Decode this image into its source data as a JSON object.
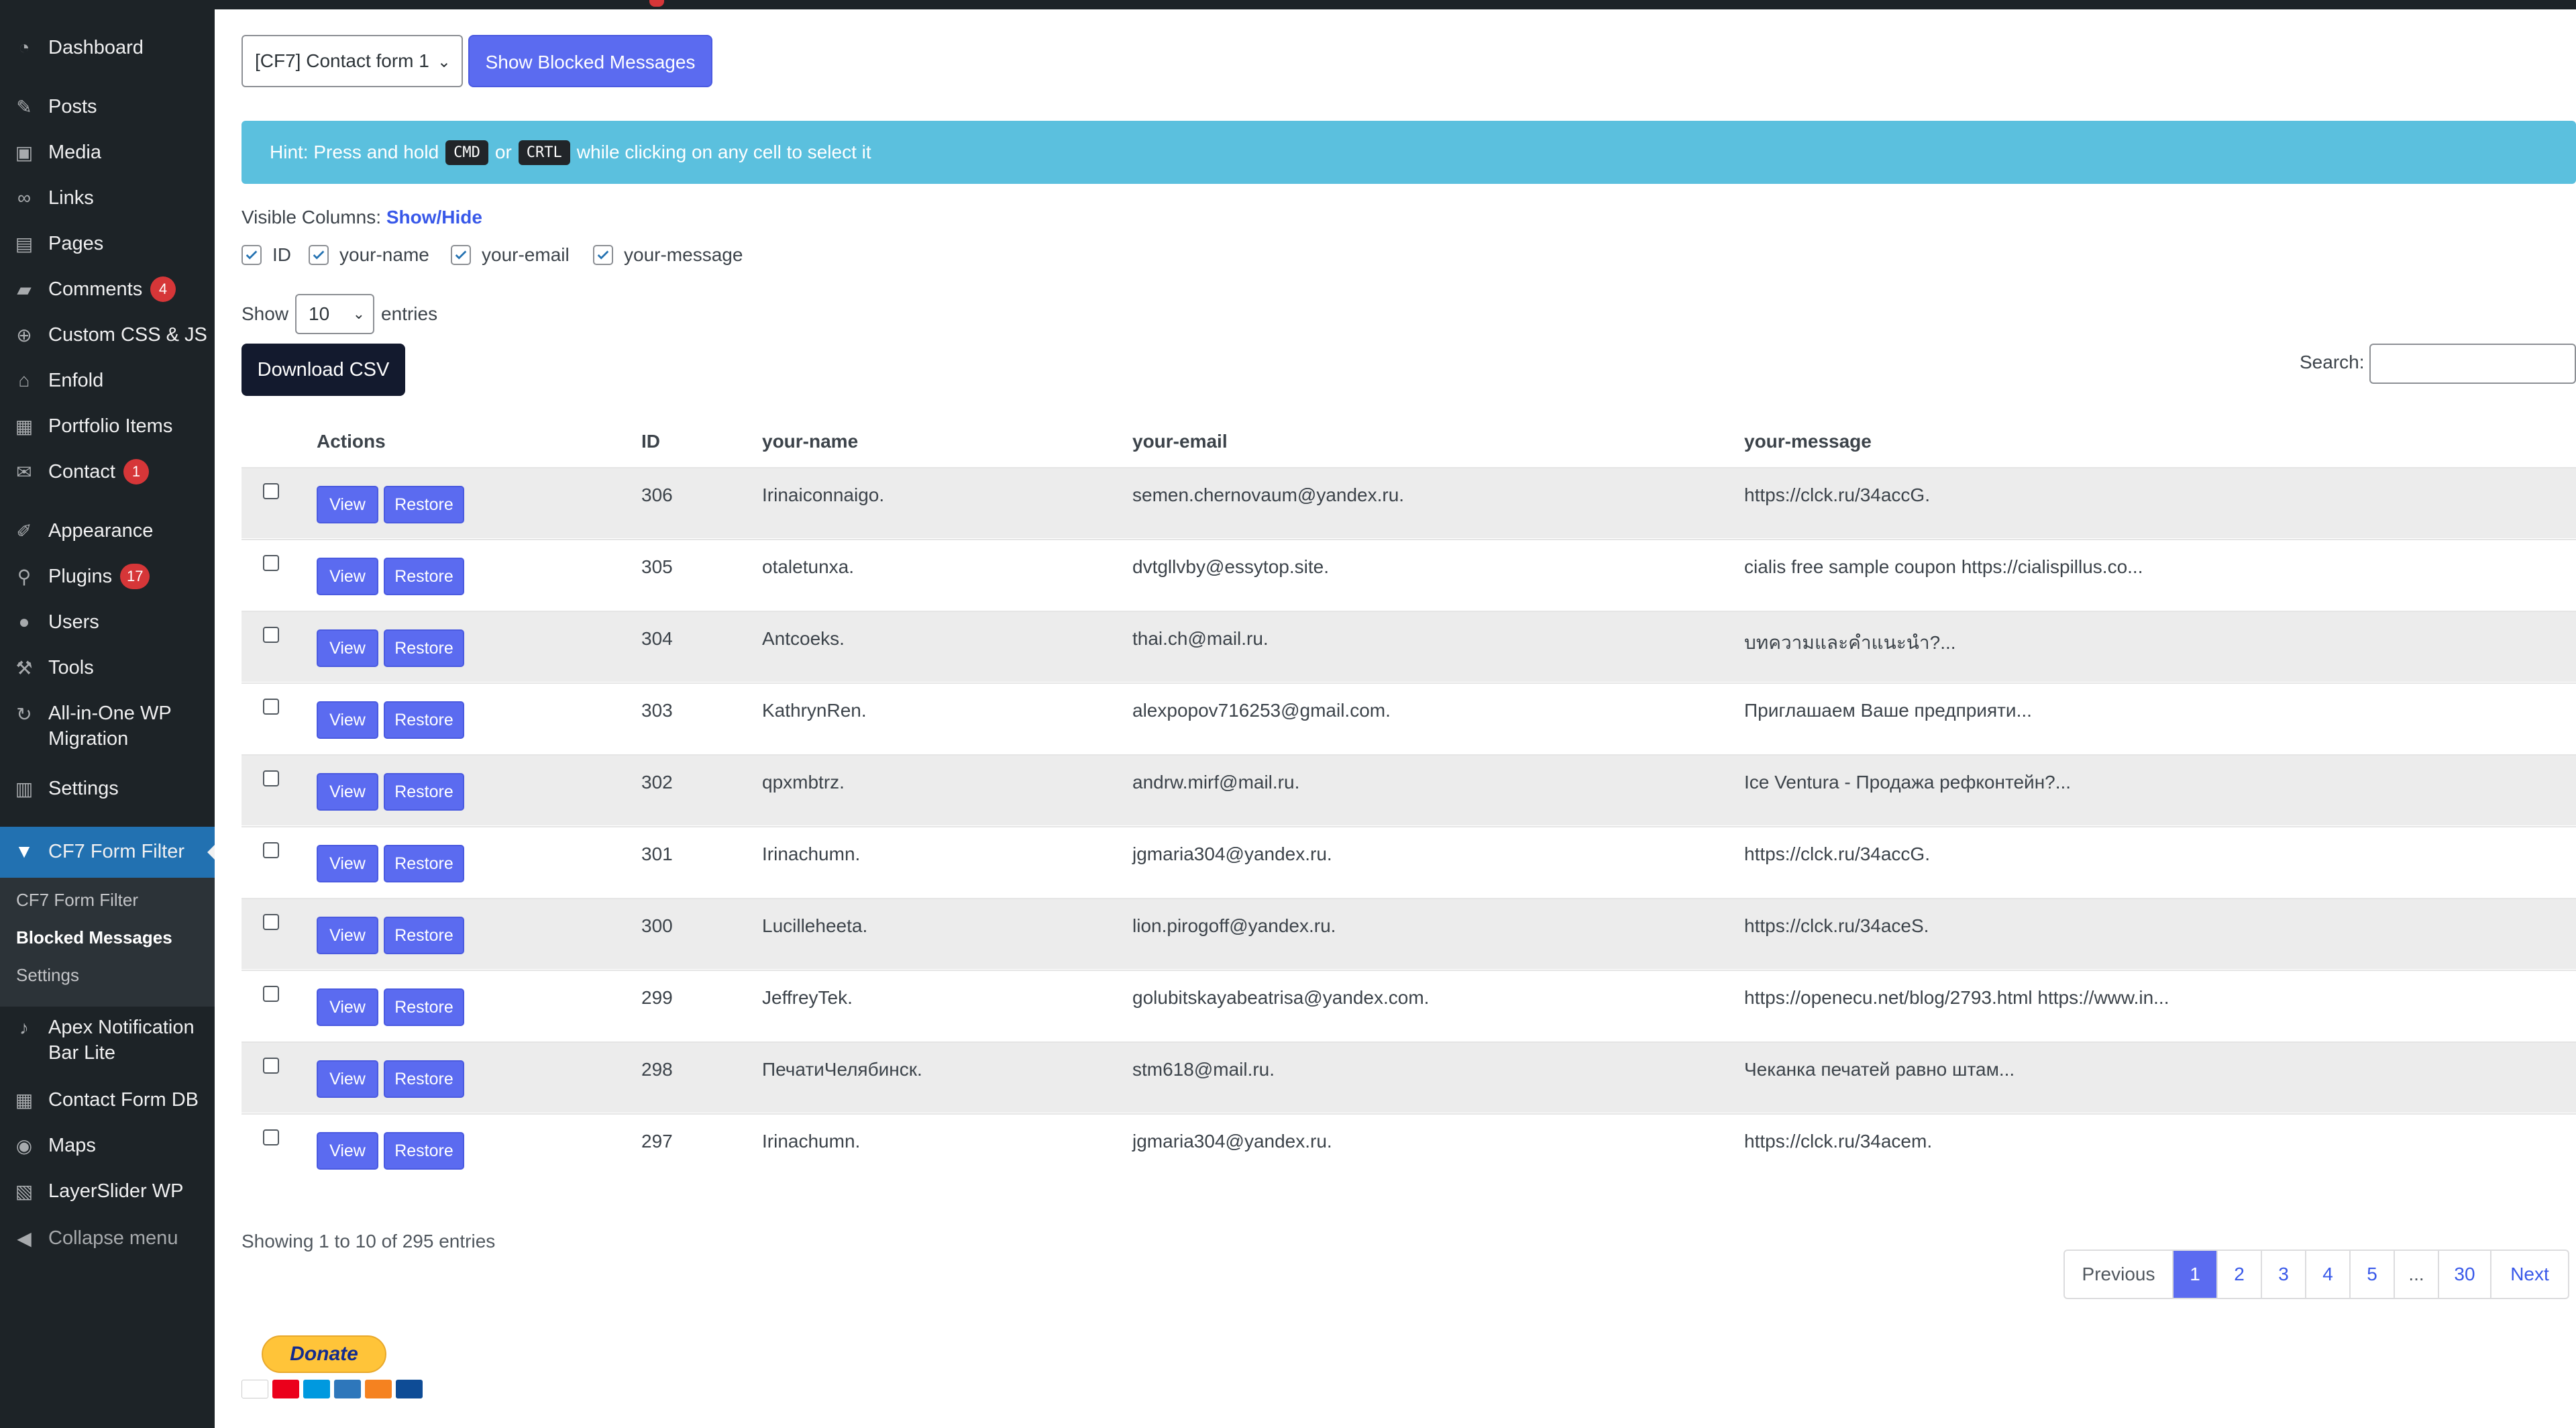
{
  "sidebar": {
    "items": [
      {
        "label": "Dashboard",
        "icon": "dashboard-icon"
      },
      {
        "label": "Posts",
        "icon": "pin-icon"
      },
      {
        "label": "Media",
        "icon": "media-icon"
      },
      {
        "label": "Links",
        "icon": "link-icon"
      },
      {
        "label": "Pages",
        "icon": "pages-icon"
      },
      {
        "label": "Comments",
        "icon": "comment-icon",
        "badge": "4"
      },
      {
        "label": "Custom CSS & JS",
        "icon": "plus-circle-icon"
      },
      {
        "label": "Enfold",
        "icon": "home-icon"
      },
      {
        "label": "Portfolio Items",
        "icon": "portfolio-icon"
      },
      {
        "label": "Contact",
        "icon": "mail-icon",
        "badge": "1"
      },
      {
        "label": "Appearance",
        "icon": "brush-icon"
      },
      {
        "label": "Plugins",
        "icon": "plugin-icon",
        "badge": "17"
      },
      {
        "label": "Users",
        "icon": "user-icon"
      },
      {
        "label": "Tools",
        "icon": "wrench-icon"
      },
      {
        "label": "All-in-One WP",
        "label2": "Migration",
        "icon": "migration-icon"
      },
      {
        "label": "Settings",
        "icon": "settings-icon"
      },
      {
        "label": "CF7 Form Filter",
        "icon": "filter-icon"
      },
      {
        "label": "Apex Notification",
        "label2": "Bar Lite",
        "icon": "microphone-icon"
      },
      {
        "label": "Contact Form DB",
        "icon": "database-icon"
      },
      {
        "label": "Maps",
        "icon": "map-pin-icon"
      },
      {
        "label": "LayerSlider WP",
        "icon": "layers-icon"
      },
      {
        "label": "Collapse menu",
        "icon": "collapse-icon"
      }
    ],
    "submenu": [
      "CF7 Form Filter",
      "Blocked Messages",
      "Settings"
    ]
  },
  "toolbar": {
    "form_select": "[CF7] Contact form 1",
    "show_blocked": "Show Blocked Messages"
  },
  "hint": {
    "prefix": "Hint: Press and hold",
    "key1": "CMD",
    "or": "or",
    "key2": "CRTL",
    "suffix": "while clicking on any cell to select it"
  },
  "visible_columns": {
    "label": "Visible Columns:",
    "link": "Show/Hide",
    "columns": [
      "ID",
      "your-name",
      "your-email",
      "your-message"
    ]
  },
  "entries": {
    "show": "Show",
    "value": "10",
    "suffix": "entries"
  },
  "download_csv": "Download CSV",
  "search_label": "Search:",
  "table": {
    "headers": [
      "Actions",
      "ID",
      "your-name",
      "your-email",
      "your-message"
    ],
    "view_label": "View",
    "restore_label": "Restore",
    "rows": [
      {
        "id": "306",
        "name": "Irinaiconnaigo.",
        "email": "semen.chernovaum@yandex.ru.",
        "message": "https://clck.ru/34accG."
      },
      {
        "id": "305",
        "name": "otaletunxa.",
        "email": "dvtgllvby@essytop.site.",
        "message": "cialis free sample coupon https://cialispillus.co..."
      },
      {
        "id": "304",
        "name": "Antcoeks.",
        "email": "thai.ch@mail.ru.",
        "message": "บทความและคำแนะนำ?..."
      },
      {
        "id": "303",
        "name": "KathrynRen.",
        "email": "alexpopov716253@gmail.com.",
        "message": "Приглашаем Ваше предприяти..."
      },
      {
        "id": "302",
        "name": "qpxmbtrz.",
        "email": "andrw.mirf@mail.ru.",
        "message": "Ice Ventura - Продажа рефконтейн?..."
      },
      {
        "id": "301",
        "name": "Irinachumn.",
        "email": "jgmaria304@yandex.ru.",
        "message": "https://clck.ru/34accG."
      },
      {
        "id": "300",
        "name": "Lucilleheeta.",
        "email": "lion.pirogoff@yandex.ru.",
        "message": "https://clck.ru/34aceS."
      },
      {
        "id": "299",
        "name": "JeffreyTek.",
        "email": "golubitskayabeatrisa@yandex.com.",
        "message": "https://openecu.net/blog/2793.html https://www.in..."
      },
      {
        "id": "298",
        "name": "ПечатиЧелябинск.",
        "email": "stm618@mail.ru.",
        "message": "Чеканка печатей равно штам..."
      },
      {
        "id": "297",
        "name": "Irinachumn.",
        "email": "jgmaria304@yandex.ru.",
        "message": "https://clck.ru/34acem."
      }
    ]
  },
  "info": "Showing 1 to 10 of 295 entries",
  "pagination": [
    "Previous",
    "1",
    "2",
    "3",
    "4",
    "5",
    "...",
    "30",
    "Next"
  ],
  "pagination_active": "1",
  "donate_label": "Donate",
  "colors": {
    "sidebar_bg": "#1d2327",
    "active_menu": "#2271b1",
    "primary_button": "#5b6bf0",
    "hint_bg": "#5bc0de",
    "download_bg": "#131a2e",
    "badge": "#d63638"
  }
}
